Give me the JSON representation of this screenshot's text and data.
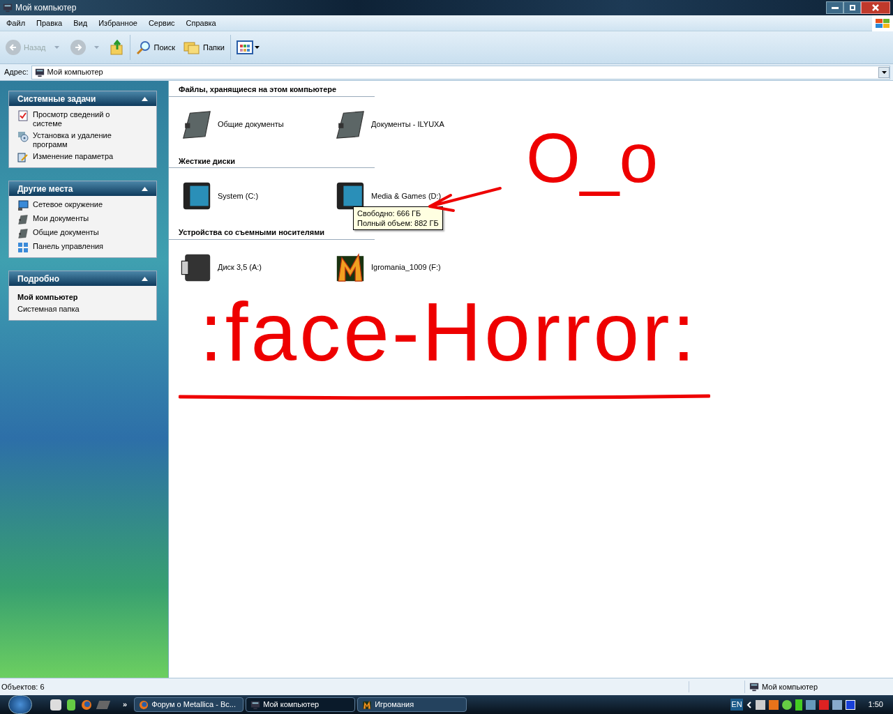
{
  "window": {
    "title": "Мой компьютер"
  },
  "menu": [
    "Файл",
    "Правка",
    "Вид",
    "Избранное",
    "Сервис",
    "Справка"
  ],
  "toolbar": {
    "back": {
      "label": "Назад",
      "disabled": true
    },
    "search": "Поиск",
    "folders": "Папки"
  },
  "address": {
    "label": "Адрес:",
    "value": "Мой компьютер"
  },
  "sidebar": [
    {
      "kind": "links",
      "title": "Системные задачи",
      "items": [
        {
          "label": "Просмотр сведений о системе",
          "kind": "sysinfo"
        },
        {
          "label": "Установка и удаление программ",
          "kind": "install"
        },
        {
          "label": "Изменение параметра",
          "kind": "settings"
        }
      ]
    },
    {
      "kind": "links",
      "title": "Другие места",
      "items": [
        {
          "label": "Сетевое окружение",
          "kind": "network"
        },
        {
          "label": "Мои документы",
          "kind": "docs"
        },
        {
          "label": "Общие документы",
          "kind": "docs"
        },
        {
          "label": "Панель управления",
          "kind": "control"
        }
      ]
    },
    {
      "kind": "details",
      "title": "Подробно",
      "name": "Мой компьютер",
      "subtitle": "Системная папка"
    }
  ],
  "groups": [
    {
      "title": "Файлы, хранящиеся на этом компьютере",
      "items": [
        {
          "label": "Общие документы",
          "kind": "docs"
        },
        {
          "label": "Документы - ILYUXA",
          "kind": "docs"
        }
      ]
    },
    {
      "title": "Жесткие диски",
      "items": [
        {
          "label": "System (C:)",
          "kind": "drive"
        },
        {
          "label": "Media & Games (D:)",
          "kind": "drive"
        }
      ]
    },
    {
      "title": "Устройства со съемными носителями",
      "items": [
        {
          "label": "Диск 3,5 (A:)",
          "kind": "floppy"
        },
        {
          "label": "Igromania_1009 (F:)",
          "kind": "game"
        }
      ]
    }
  ],
  "tooltip": [
    "Свободно: 666 ГБ",
    "Полный объем: 882 ГБ"
  ],
  "annotations": [
    {
      "kind": "small",
      "text": "O_o"
    },
    {
      "kind": "big",
      "text": ":face-Horror:"
    }
  ],
  "status": {
    "objects": "Объектов: 6",
    "location": "Мой компьютер"
  },
  "taskbar": {
    "more": "»",
    "tasks": [
      {
        "label": "Форум о Metallica - Вс...",
        "kind": "browser",
        "selected": false
      },
      {
        "label": "Мой компьютер",
        "kind": "computer",
        "selected": true
      },
      {
        "label": "Игромания",
        "kind": "game",
        "selected": false
      }
    ],
    "lang": "EN",
    "clock": "1:50"
  }
}
